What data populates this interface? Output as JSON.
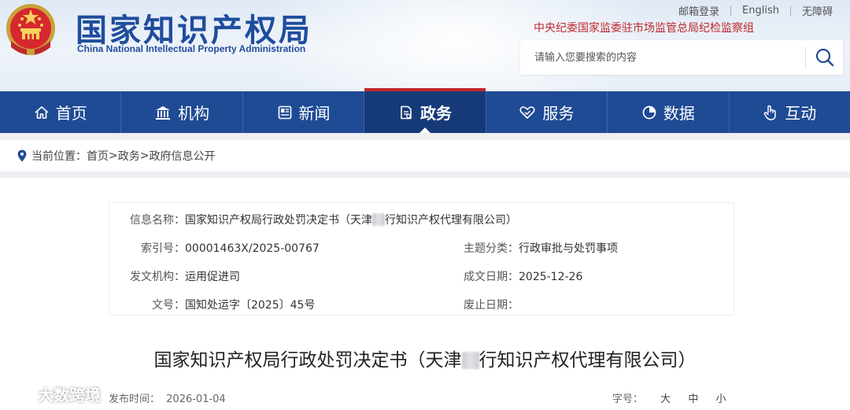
{
  "header": {
    "brand_cn": "国家知识产权局",
    "brand_en": "China National Intellectual Property Administration",
    "top_links": [
      "邮箱登录",
      "English",
      "无障碍"
    ],
    "discipline_link": "中央纪委国家监委驻市场监管总局纪检监察组",
    "search": {
      "placeholder": "请输入您要搜索的内容"
    }
  },
  "nav": {
    "items": [
      {
        "label": "首页",
        "icon": "home-icon"
      },
      {
        "label": "机构",
        "icon": "institution-icon"
      },
      {
        "label": "新闻",
        "icon": "news-icon"
      },
      {
        "label": "政务",
        "icon": "government-affairs-icon",
        "active": true
      },
      {
        "label": "服务",
        "icon": "service-icon"
      },
      {
        "label": "数据",
        "icon": "data-pie-icon"
      },
      {
        "label": "互动",
        "icon": "interaction-hand-icon"
      }
    ]
  },
  "breadcrumb": {
    "prefix": "当前位置：",
    "items": [
      "首页",
      "政务",
      "政府信息公开"
    ],
    "separator": ">"
  },
  "info": {
    "name_label": "信息名称：",
    "name_value_a": "国家知识产权局行政处罚决定书（天津",
    "name_value_b": "行知识产权代理有限公司）",
    "index_label": "索引号：",
    "index_value": "00001463X/2025-00767",
    "category_label": "主题分类：",
    "category_value": "行政审批与处罚事项",
    "issuer_label": "发文机构：",
    "issuer_value": "运用促进司",
    "date_label": "成文日期：",
    "date_value": "2025-12-26",
    "doc_no_label": "文号：",
    "doc_no_value": "国知处运字〔2025〕45号",
    "expiry_label": "废止日期：",
    "expiry_value": ""
  },
  "document": {
    "title_a": "国家知识产权局行政处罚决定书（天津",
    "title_b": "行知识产权代理有限公司）",
    "publish_label": "发布时间：",
    "publish_date": "2026-01-04",
    "font_size_label": "字号：",
    "font_sizes": [
      "大",
      "中",
      "小"
    ]
  },
  "watermark": {
    "text": "大数跨境"
  },
  "colors": {
    "nav_bg": "#1f4b95",
    "nav_active": "#163a78",
    "brand": "#1f4d9d",
    "accent_red": "#c1272d"
  }
}
